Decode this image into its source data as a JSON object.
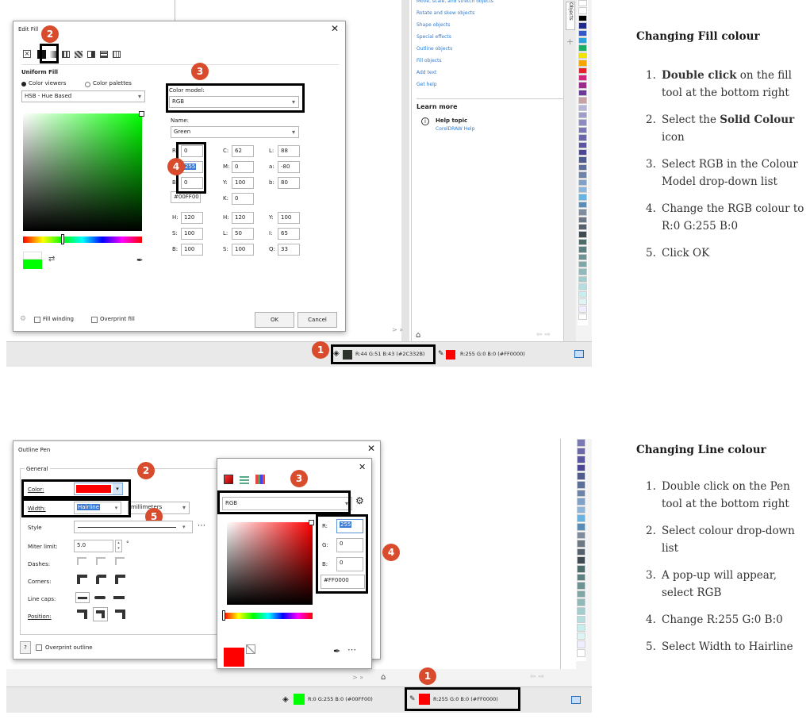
{
  "top": {
    "dialog_title": "Edit Fill",
    "section_title": "Uniform Fill",
    "radio_viewers": "Color viewers",
    "radio_palettes": "Color palettes",
    "viewer_select": "HSB - Hue Based",
    "color_model_label": "Color model:",
    "color_model_value": "RGB",
    "name_label": "Name:",
    "name_value": "Green",
    "rgb": {
      "r_label": "R:",
      "r": "0",
      "g_label": "G:",
      "g": "255",
      "b_label": "B:",
      "b": "0"
    },
    "hex": "#00FF00",
    "cmyk": {
      "c_label": "C:",
      "c": "62",
      "m_label": "M:",
      "m": "0",
      "y_label": "Y:",
      "y": "100",
      "k_label": "K:",
      "k": "0"
    },
    "lab": {
      "l_label": "L:",
      "l": "88",
      "a_label": "a:",
      "a": "-80",
      "b_label": "b:",
      "b": "80"
    },
    "hsb": {
      "h_label": "H:",
      "h": "120",
      "s_label": "S:",
      "s": "100",
      "b_label": "B:",
      "b": "100"
    },
    "hls": {
      "h_label": "H:",
      "h": "120",
      "l_label": "L:",
      "l": "50",
      "s_label": "S:",
      "s": "100"
    },
    "yiq": {
      "y_label": "Y:",
      "y": "100",
      "i_label": "I:",
      "i": "65",
      "q_label": "Q:",
      "q": "33"
    },
    "fill_winding": "Fill winding",
    "overprint_fill": "Overprint fill",
    "ok": "OK",
    "cancel": "Cancel",
    "links": [
      "Move, scale, and stretch objects",
      "Rotate and skew objects",
      "Shape objects",
      "Special effects",
      "Outline objects",
      "Fill objects",
      "Add text",
      "Get help"
    ],
    "learn_more": "Learn more",
    "help_topic": "Help topic",
    "help_sub": "CorelDRAW Help",
    "objects_tab": "Objects",
    "status_fill": "R:44 G:51 B:43 (#2C332B)",
    "status_outline": "R:255 G:0 B:0 (#FF0000)",
    "nav_arrows": "> »",
    "markers": [
      "1",
      "2",
      "3",
      "4"
    ]
  },
  "bottom": {
    "dialog_title": "Outline Pen",
    "general": "General",
    "color_label": "Color:",
    "width_label": "Width:",
    "width_value": "Hairline",
    "units_value": "millimeters",
    "style_label": "Style",
    "miter_label": "Miter limit:",
    "miter_value": "5.0",
    "miter_unit": "°",
    "dashes_label": "Dashes:",
    "corners_label": "Corners:",
    "linecaps_label": "Line caps:",
    "position_label": "Position:",
    "overprint_outline": "Overprint outline",
    "help_btn": "?",
    "popup_model": "RGB",
    "popup_r_label": "R:",
    "popup_r": "255",
    "popup_g_label": "G:",
    "popup_g": "0",
    "popup_b_label": "B:",
    "popup_b": "0",
    "popup_hex": "#FF0000",
    "status_fill": "R:0 G:255 B:0 (#00FF00)",
    "status_outline": "R:255 G:0 B:0 (#FF0000)",
    "nav_arrows": "> »",
    "markers": [
      "1",
      "2",
      "3",
      "4",
      "5"
    ]
  },
  "fill_section": {
    "title": "Changing Fill colour",
    "steps": [
      {
        "num": "1.",
        "bold": "Double click",
        "text": " on the fill tool at the bottom right"
      },
      {
        "num": "2.",
        "pre": "Select the ",
        "bold": "Solid Colour",
        "text": " icon"
      },
      {
        "num": "3.",
        "text": "Select RGB in the Colour Model drop-down list"
      },
      {
        "num": "4.",
        "text": "Change the RGB colour to R:0 G:255 B:0"
      },
      {
        "num": "5.",
        "text": "Click OK"
      }
    ]
  },
  "line_section": {
    "title": "Changing Line colour",
    "steps": [
      {
        "num": "1.",
        "text": "Double click on the Pen tool at the bottom right"
      },
      {
        "num": "2.",
        "text": "Select colour drop-down list"
      },
      {
        "num": "3.",
        "text": "A pop-up will appear, select RGB"
      },
      {
        "num": "4.",
        "text": "Change R:255 G:0 B:0"
      },
      {
        "num": "5.",
        "text": "Select Width to Hairline"
      }
    ]
  },
  "colors": {
    "marker": "#d84b2c",
    "green": "#00ff00",
    "red": "#ff0000",
    "dark_swatch": "#2c332b"
  }
}
